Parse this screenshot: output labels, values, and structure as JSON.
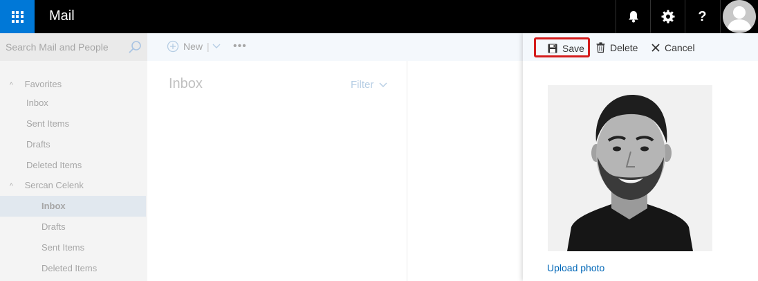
{
  "header": {
    "app_title": "Mail",
    "icons": [
      "waffle-icon",
      "bell-icon",
      "gear-icon",
      "help-icon",
      "avatar"
    ]
  },
  "search": {
    "placeholder": "Search Mail and People"
  },
  "sidebar": {
    "favorites_label": "Favorites",
    "favorites": [
      {
        "label": "Inbox"
      },
      {
        "label": "Sent Items"
      },
      {
        "label": "Drafts"
      },
      {
        "label": "Deleted Items"
      }
    ],
    "account_label": "Sercan Celenk",
    "account_items": [
      {
        "label": "Inbox",
        "selected": true
      },
      {
        "label": "Drafts"
      },
      {
        "label": "Sent Items"
      },
      {
        "label": "Deleted Items"
      }
    ]
  },
  "toolbar": {
    "new_label": "New",
    "more_label": "•••"
  },
  "message_list": {
    "folder_title": "Inbox",
    "filter_label": "Filter"
  },
  "panel": {
    "save_label": "Save",
    "delete_label": "Delete",
    "cancel_label": "Cancel",
    "upload_label": "Upload photo"
  },
  "colors": {
    "topbar": "#000000",
    "waffle": "#0078d7",
    "highlight_border": "#d41b1b",
    "link": "#0067b8"
  }
}
